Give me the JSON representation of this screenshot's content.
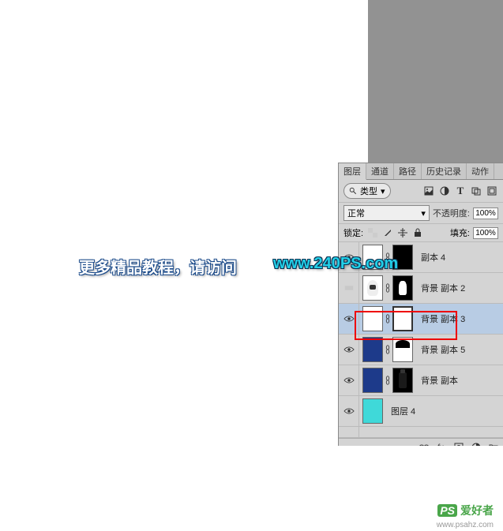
{
  "overlay": {
    "text": "更多精品教程，请访问",
    "url": "www.240PS.com"
  },
  "watermark": {
    "badge": "PS",
    "text": "爱好者",
    "domain": "www.psahz.com"
  },
  "panel": {
    "tabs": [
      "图层",
      "通道",
      "路径",
      "历史记录",
      "动作"
    ],
    "filter_label": "类型",
    "blend_mode": "正常",
    "opacity_label": "不透明度:",
    "opacity_value": "100%",
    "lock_label": "锁定:",
    "fill_label": "填充:",
    "fill_value": "100%"
  },
  "layers": [
    {
      "name": "副本 4",
      "visible": true
    },
    {
      "name": "背景 副本 2",
      "visible": false
    },
    {
      "name": "背景 副本 3",
      "visible": true,
      "selected": true
    },
    {
      "name": "背景 副本 5",
      "visible": true
    },
    {
      "name": "背景 副本",
      "visible": true
    },
    {
      "name": "图层 4",
      "visible": true
    }
  ],
  "footer": {
    "fx_label": "fx."
  }
}
